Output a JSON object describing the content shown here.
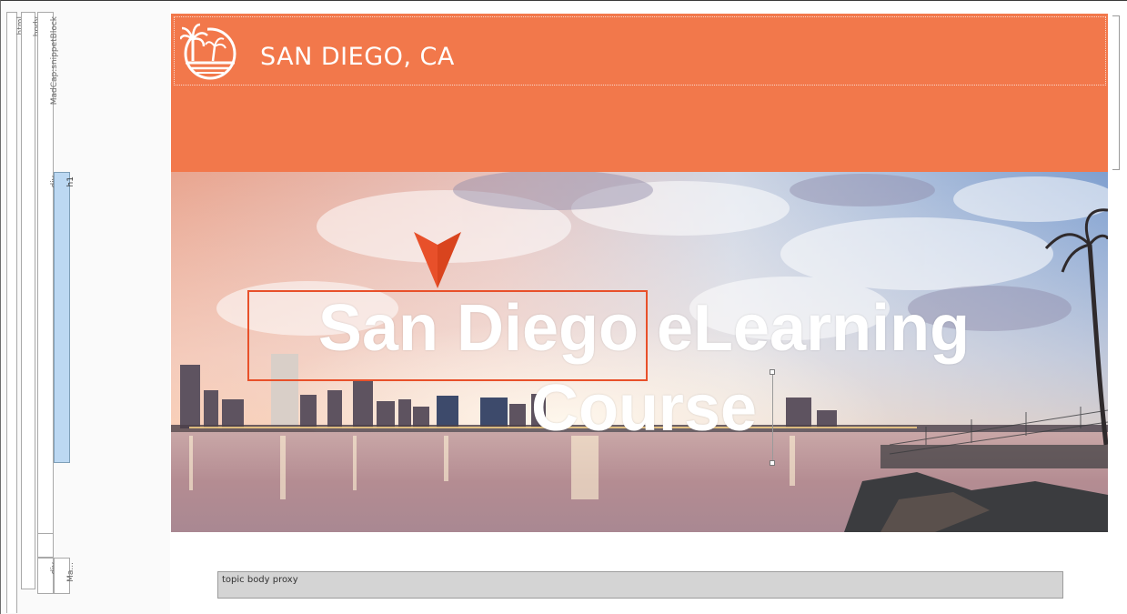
{
  "structure_bars": {
    "html": "html",
    "body": "body",
    "snippet_block": "MadCap:snippetBlock",
    "div_1": "div",
    "h1": "h1",
    "div_2": "div",
    "madcap_short": "Ma..."
  },
  "banner": {
    "logo_text": "SAN DIEGO, CA",
    "logo_icon": "palm-tree-logo-icon",
    "background_color": "#f2784b"
  },
  "hero": {
    "heading": "San Diego eLearning Course",
    "image": "san-diego-skyline-photo"
  },
  "annotations": {
    "highlight_color": "#e8502a",
    "pointer_icon": "arrow-pointer-icon"
  },
  "proxy": {
    "label": "topic body proxy"
  }
}
